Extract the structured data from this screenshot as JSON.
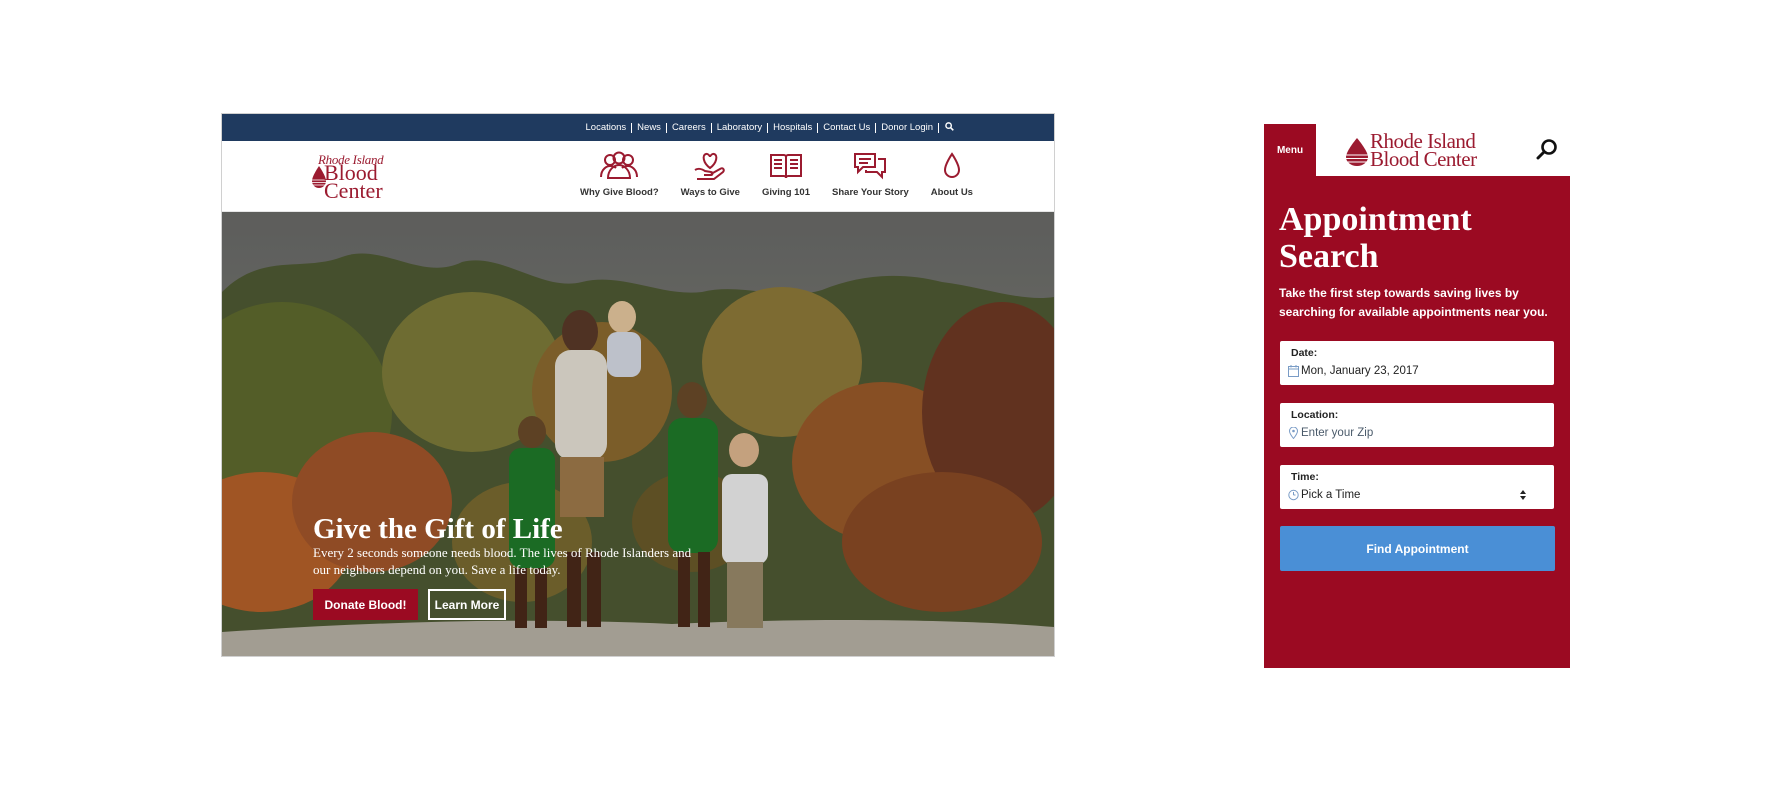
{
  "colors": {
    "brand_red": "#9b0a22",
    "utility_bar": "#1f3a5f",
    "find_button": "#4a8fd6"
  },
  "desktop": {
    "utility_links": [
      "Locations",
      "News",
      "Careers",
      "Laboratory",
      "Hospitals",
      "Contact Us",
      "Donor Login"
    ],
    "logo": {
      "line1": "Rhode Island",
      "line2": "Blood",
      "line3": "Center"
    },
    "nav": [
      {
        "label": "Why Give Blood?",
        "icon": "people-icon"
      },
      {
        "label": "Ways to Give",
        "icon": "heart-hand-icon"
      },
      {
        "label": "Giving 101",
        "icon": "book-icon"
      },
      {
        "label": "Share Your Story",
        "icon": "speech-bubbles-icon"
      },
      {
        "label": "About Us",
        "icon": "blood-drop-icon"
      }
    ],
    "hero": {
      "title": "Give the Gift of Life",
      "subtitle": "Every 2 seconds someone needs blood. The lives of Rhode Islanders and our neighbors depend on you. Save a life today.",
      "primary_button": "Donate Blood!",
      "secondary_button": "Learn More"
    }
  },
  "mobile": {
    "menu_label": "Menu",
    "logo": {
      "line1": "Rhode Island",
      "line2": "Blood Center"
    },
    "title": "Appointment Search",
    "description": "Take the first step towards saving lives by searching for available appointments near you.",
    "fields": {
      "date": {
        "label": "Date:",
        "value": "Mon, January 23, 2017",
        "icon": "calendar-icon"
      },
      "location": {
        "label": "Location:",
        "placeholder": "Enter your Zip",
        "icon": "map-pin-icon"
      },
      "time": {
        "label": "Time:",
        "value": "Pick a Time",
        "icon": "clock-icon"
      }
    },
    "submit_button": "Find Appointment"
  }
}
